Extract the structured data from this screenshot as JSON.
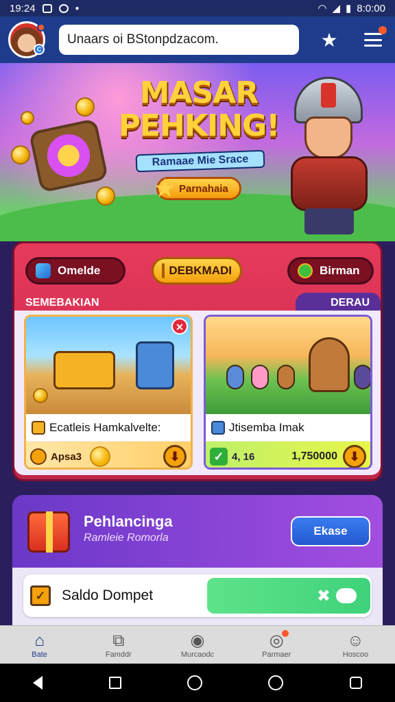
{
  "status_bar": {
    "time": "19:24",
    "clock_right": "8:0:00",
    "icons": [
      "x-box-icon",
      "circle-icon",
      "wifi-icon",
      "signal-icon",
      "battery-icon"
    ]
  },
  "app_bar": {
    "search": {
      "value": "Unaars oi BStonpdzacom."
    },
    "icons": [
      "avatar",
      "star-icon",
      "menu-icon"
    ]
  },
  "hero": {
    "title_line1": "MASAR",
    "title_line2": "PEHKING!",
    "subtitle": "Ramaae Mie Srace",
    "button": "Parnahaia"
  },
  "quick_actions": [
    {
      "label": "Omelde"
    },
    {
      "label": "DEBKMADI"
    },
    {
      "label": "Birman"
    }
  ],
  "section": {
    "left_title": "SEMEBAKIAN",
    "right_tab": "DERAU"
  },
  "cards": [
    {
      "title": "Ecatleis Hamkalvelte:",
      "price": "Apsa3"
    },
    {
      "title": "Jtisemba Imak",
      "badge": "4, 16",
      "value": "1,750000"
    }
  ],
  "promo": {
    "title": "Pehlancinga",
    "subtitle": "Ramleie Romorla",
    "button": "Ekase"
  },
  "wallet": {
    "label": "Saldo Dompet"
  },
  "bottom_nav": [
    {
      "label": "Bate",
      "icon": "home-icon"
    },
    {
      "label": "Famddr",
      "icon": "cart-icon"
    },
    {
      "label": "Murcaodc",
      "icon": "globe-icon"
    },
    {
      "label": "Parmaer",
      "icon": "chat-icon"
    },
    {
      "label": "Hoscoo",
      "icon": "profile-icon"
    }
  ],
  "colors": {
    "app_bar": "#1f3c8c",
    "section_bg": "#e63a5c",
    "promo_bg": "#a24ee0",
    "wallet_button": "#3fd27a"
  }
}
